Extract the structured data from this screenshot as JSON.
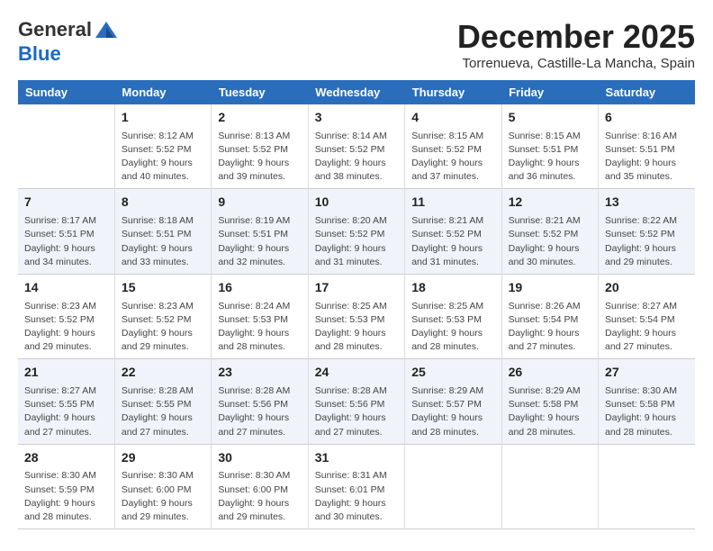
{
  "header": {
    "logo_line1": "General",
    "logo_line2": "Blue",
    "title": "December 2025",
    "subtitle": "Torrenueva, Castille-La Mancha, Spain"
  },
  "columns": [
    "Sunday",
    "Monday",
    "Tuesday",
    "Wednesday",
    "Thursday",
    "Friday",
    "Saturday"
  ],
  "weeks": [
    [
      {
        "day": "",
        "info": ""
      },
      {
        "day": "1",
        "info": "Sunrise: 8:12 AM\nSunset: 5:52 PM\nDaylight: 9 hours\nand 40 minutes."
      },
      {
        "day": "2",
        "info": "Sunrise: 8:13 AM\nSunset: 5:52 PM\nDaylight: 9 hours\nand 39 minutes."
      },
      {
        "day": "3",
        "info": "Sunrise: 8:14 AM\nSunset: 5:52 PM\nDaylight: 9 hours\nand 38 minutes."
      },
      {
        "day": "4",
        "info": "Sunrise: 8:15 AM\nSunset: 5:52 PM\nDaylight: 9 hours\nand 37 minutes."
      },
      {
        "day": "5",
        "info": "Sunrise: 8:15 AM\nSunset: 5:51 PM\nDaylight: 9 hours\nand 36 minutes."
      },
      {
        "day": "6",
        "info": "Sunrise: 8:16 AM\nSunset: 5:51 PM\nDaylight: 9 hours\nand 35 minutes."
      }
    ],
    [
      {
        "day": "7",
        "info": "Sunrise: 8:17 AM\nSunset: 5:51 PM\nDaylight: 9 hours\nand 34 minutes."
      },
      {
        "day": "8",
        "info": "Sunrise: 8:18 AM\nSunset: 5:51 PM\nDaylight: 9 hours\nand 33 minutes."
      },
      {
        "day": "9",
        "info": "Sunrise: 8:19 AM\nSunset: 5:51 PM\nDaylight: 9 hours\nand 32 minutes."
      },
      {
        "day": "10",
        "info": "Sunrise: 8:20 AM\nSunset: 5:52 PM\nDaylight: 9 hours\nand 31 minutes."
      },
      {
        "day": "11",
        "info": "Sunrise: 8:21 AM\nSunset: 5:52 PM\nDaylight: 9 hours\nand 31 minutes."
      },
      {
        "day": "12",
        "info": "Sunrise: 8:21 AM\nSunset: 5:52 PM\nDaylight: 9 hours\nand 30 minutes."
      },
      {
        "day": "13",
        "info": "Sunrise: 8:22 AM\nSunset: 5:52 PM\nDaylight: 9 hours\nand 29 minutes."
      }
    ],
    [
      {
        "day": "14",
        "info": "Sunrise: 8:23 AM\nSunset: 5:52 PM\nDaylight: 9 hours\nand 29 minutes."
      },
      {
        "day": "15",
        "info": "Sunrise: 8:23 AM\nSunset: 5:52 PM\nDaylight: 9 hours\nand 29 minutes."
      },
      {
        "day": "16",
        "info": "Sunrise: 8:24 AM\nSunset: 5:53 PM\nDaylight: 9 hours\nand 28 minutes."
      },
      {
        "day": "17",
        "info": "Sunrise: 8:25 AM\nSunset: 5:53 PM\nDaylight: 9 hours\nand 28 minutes."
      },
      {
        "day": "18",
        "info": "Sunrise: 8:25 AM\nSunset: 5:53 PM\nDaylight: 9 hours\nand 28 minutes."
      },
      {
        "day": "19",
        "info": "Sunrise: 8:26 AM\nSunset: 5:54 PM\nDaylight: 9 hours\nand 27 minutes."
      },
      {
        "day": "20",
        "info": "Sunrise: 8:27 AM\nSunset: 5:54 PM\nDaylight: 9 hours\nand 27 minutes."
      }
    ],
    [
      {
        "day": "21",
        "info": "Sunrise: 8:27 AM\nSunset: 5:55 PM\nDaylight: 9 hours\nand 27 minutes."
      },
      {
        "day": "22",
        "info": "Sunrise: 8:28 AM\nSunset: 5:55 PM\nDaylight: 9 hours\nand 27 minutes."
      },
      {
        "day": "23",
        "info": "Sunrise: 8:28 AM\nSunset: 5:56 PM\nDaylight: 9 hours\nand 27 minutes."
      },
      {
        "day": "24",
        "info": "Sunrise: 8:28 AM\nSunset: 5:56 PM\nDaylight: 9 hours\nand 27 minutes."
      },
      {
        "day": "25",
        "info": "Sunrise: 8:29 AM\nSunset: 5:57 PM\nDaylight: 9 hours\nand 28 minutes."
      },
      {
        "day": "26",
        "info": "Sunrise: 8:29 AM\nSunset: 5:58 PM\nDaylight: 9 hours\nand 28 minutes."
      },
      {
        "day": "27",
        "info": "Sunrise: 8:30 AM\nSunset: 5:58 PM\nDaylight: 9 hours\nand 28 minutes."
      }
    ],
    [
      {
        "day": "28",
        "info": "Sunrise: 8:30 AM\nSunset: 5:59 PM\nDaylight: 9 hours\nand 28 minutes."
      },
      {
        "day": "29",
        "info": "Sunrise: 8:30 AM\nSunset: 6:00 PM\nDaylight: 9 hours\nand 29 minutes."
      },
      {
        "day": "30",
        "info": "Sunrise: 8:30 AM\nSunset: 6:00 PM\nDaylight: 9 hours\nand 29 minutes."
      },
      {
        "day": "31",
        "info": "Sunrise: 8:31 AM\nSunset: 6:01 PM\nDaylight: 9 hours\nand 30 minutes."
      },
      {
        "day": "",
        "info": ""
      },
      {
        "day": "",
        "info": ""
      },
      {
        "day": "",
        "info": ""
      }
    ]
  ]
}
